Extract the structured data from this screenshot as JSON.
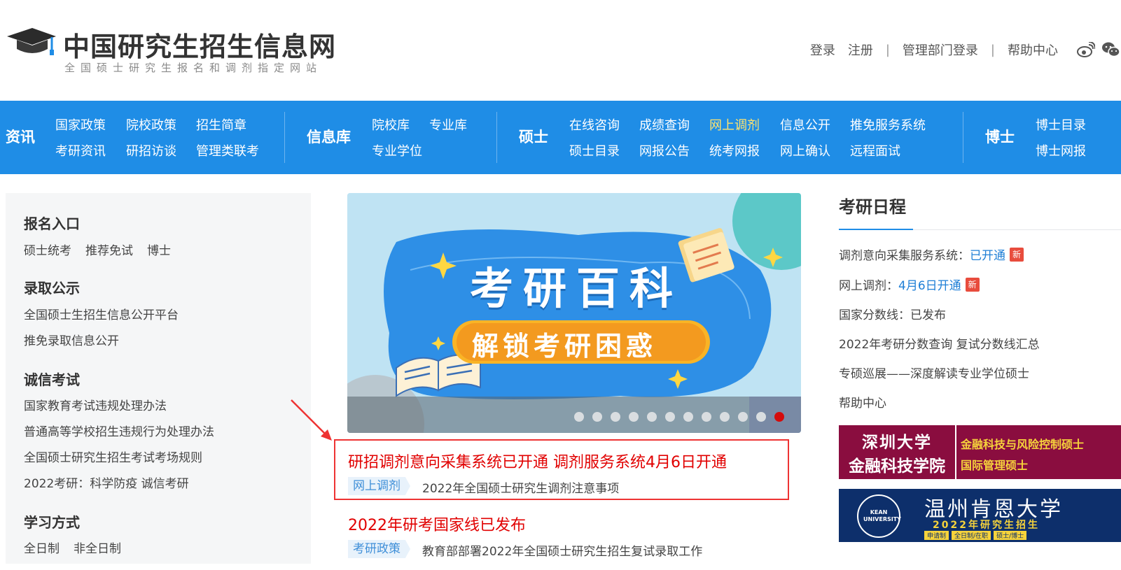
{
  "header": {
    "logo_title": "中国研究生招生信息网",
    "logo_subtitle": "全国硕士研究生报名和调剂指定网站",
    "links": [
      "登录",
      "注册",
      "|",
      "管理部门登录",
      "|",
      "帮助中心"
    ],
    "icons": [
      "weibo-icon",
      "wechat-icon"
    ]
  },
  "nav": {
    "groups": [
      {
        "title": "资讯",
        "row1": [
          "国家政策",
          "院校政策",
          "招生简章"
        ],
        "row2": [
          "考研资讯",
          "研招访谈",
          "管理类联考"
        ]
      },
      {
        "title": "信息库",
        "row1": [
          "院校库",
          "专业库"
        ],
        "row2": [
          "专业学位"
        ]
      },
      {
        "title": "硕士",
        "row1": [
          "在线咨询",
          "成绩查询",
          "网上调剂",
          "信息公开",
          "推免服务系统"
        ],
        "row2": [
          "硕士目录",
          "网报公告",
          "统考网报",
          "网上确认",
          "远程面试"
        ]
      },
      {
        "title": "博士",
        "row1": [
          "博士目录"
        ],
        "row2": [
          "博士网报"
        ]
      }
    ],
    "highlight": "网上调剂"
  },
  "left": {
    "s1_title": "报名入口",
    "s1_links": [
      "硕士统考",
      "推荐免试",
      "博士"
    ],
    "s2_title": "录取公示",
    "s2_links": [
      "全国硕士生招生信息公开平台",
      "推免录取信息公开"
    ],
    "s3_title": "诚信考试",
    "s3_links": [
      "国家教育考试违规处理办法",
      "普通高等学校招生违规行为处理办法",
      "全国硕士研究生招生考试考场规则",
      "2022考研：科学防疫 诚信考研"
    ],
    "s4_title": "学习方式",
    "s4_links": [
      "全日制",
      "非全日制"
    ]
  },
  "banner": {
    "headline": "考研百科",
    "ribbon": "解锁考研困惑",
    "dot_count": 12,
    "active_dot": 11
  },
  "news": [
    {
      "title": "研招调剂意向采集系统已开通 调剂服务系统4月6日开通",
      "tag": "网上调剂",
      "desc": "2022年全国硕士研究生调剂注意事项"
    },
    {
      "title": "2022年研考国家线已发布",
      "tag": "考研政策",
      "desc": "教育部部署2022年全国硕士研究生招生复试录取工作"
    }
  ],
  "schedule": {
    "title": "考研日程",
    "items": [
      {
        "label": "调剂意向采集服务系统：",
        "value": "已开通",
        "badge": "新"
      },
      {
        "label": "网上调剂：",
        "value": "4月6日开通",
        "badge": "新"
      },
      {
        "label": "国家分数线：已发布"
      },
      {
        "label": "2022年考研分数查询 复试分数线汇总"
      },
      {
        "label": "专硕巡展——深度解读专业学位硕士"
      },
      {
        "label": "帮助中心"
      }
    ]
  },
  "ads": {
    "ad1_left_l1": "深圳大学",
    "ad1_left_l2": "金融科技学院",
    "ad1_right_l1": "金融科技与风险控制硕士",
    "ad1_right_l2": "国际管理硕士",
    "ad2_title": "温州肯恩大学",
    "ad2_sub": "2022年研究生招生",
    "ad2_seal": "KEAN UNIVERSITY",
    "ad2_tags": [
      "申请制",
      "全日制/在职",
      "硕士/博士"
    ]
  },
  "colors": {
    "nav_bg": "#1f8de6",
    "accent_red": "#e10000",
    "nav_highlight": "#ffe36e",
    "link_blue": "#1f7fd6"
  }
}
